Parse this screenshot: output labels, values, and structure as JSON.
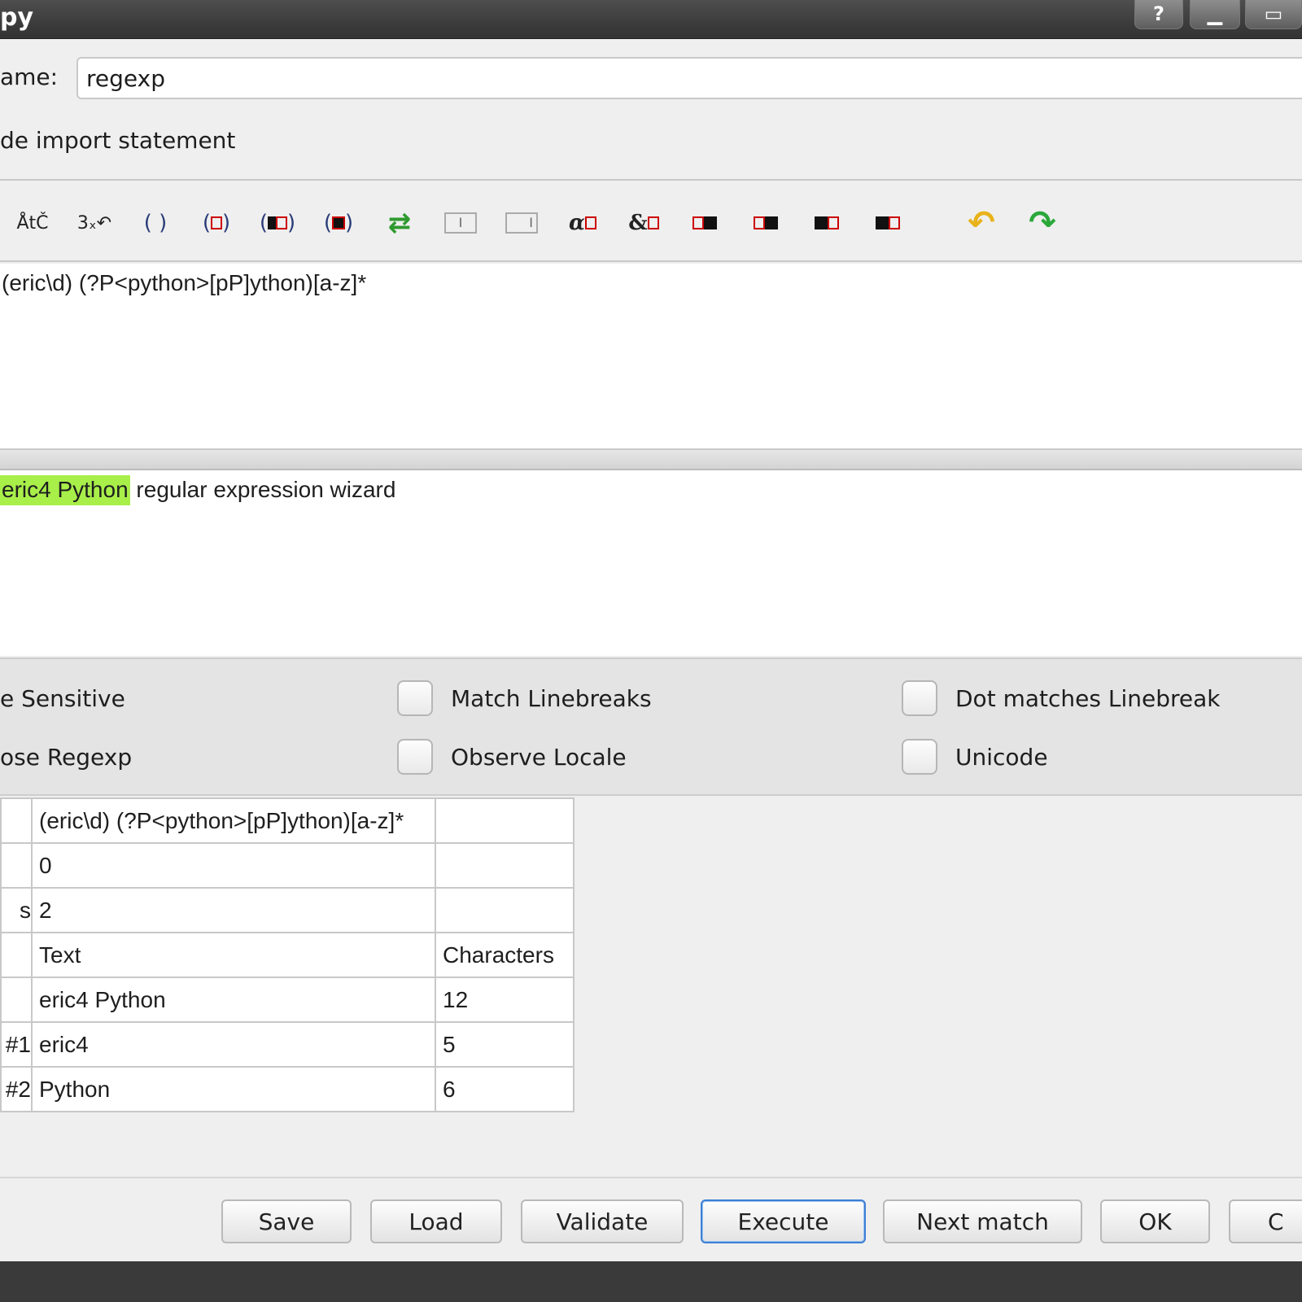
{
  "window": {
    "title": "py",
    "help_label": "?",
    "minimize_label": "▁",
    "maximize_label": "▭"
  },
  "form": {
    "name_label": "ame:",
    "name_value": "regexp",
    "import_label": "de import statement"
  },
  "toolbar": {
    "tools": [
      {
        "name": "character-tool-icon",
        "glyph": "ÅtČ"
      },
      {
        "name": "repeat-tool-icon",
        "glyph": "3ₓ↶"
      },
      {
        "name": "group-tool-icon",
        "glyph": "( )"
      },
      {
        "name": "named-group-tool-icon",
        "glyph": "(□)"
      },
      {
        "name": "named-reference-tool-icon",
        "glyph": "(▯□)"
      },
      {
        "name": "group-reference-tool-icon",
        "glyph": "(▮)"
      },
      {
        "name": "alternatives-tool-icon",
        "glyph": "⇄"
      },
      {
        "name": "begin-line-tool-icon",
        "glyph": "I"
      },
      {
        "name": "end-line-tool-icon",
        "glyph": "I"
      },
      {
        "name": "word-boundary-tool-icon",
        "glyph": "α"
      },
      {
        "name": "comment-tool-icon",
        "glyph": "&"
      },
      {
        "name": "positive-lookahead-tool-icon",
        "glyph": "+"
      },
      {
        "name": "negative-lookahead-tool-icon",
        "glyph": "−"
      },
      {
        "name": "positive-lookbehind-tool-icon",
        "glyph": "+"
      },
      {
        "name": "negative-lookbehind-tool-icon",
        "glyph": "−"
      },
      {
        "name": "undo-icon",
        "glyph": "↶"
      },
      {
        "name": "redo-icon",
        "glyph": "↷"
      }
    ]
  },
  "editor": {
    "regex": "(eric\\d) (?P<python>[pP]ython)[a-z]*"
  },
  "test": {
    "highlighted": "eric4 Python",
    "rest": " regular expression wizard"
  },
  "options": {
    "case_sensitive": "e Sensitive",
    "verbose_regexp": "ose Regexp",
    "match_linebreaks": "Match Linebreaks",
    "observe_locale": "Observe Locale",
    "dot_matches_linebreak": "Dot matches Linebreak",
    "unicode": "Unicode"
  },
  "results": {
    "rows": [
      {
        "label": "",
        "text": "(eric\\d) (?P<python>[pP]ython)[a-z]*",
        "chars": ""
      },
      {
        "label": "",
        "text": "0",
        "chars": ""
      },
      {
        "label": "s",
        "text": "2",
        "chars": ""
      },
      {
        "label": "",
        "text": "Text",
        "chars": "Characters"
      },
      {
        "label": "",
        "text": "eric4 Python",
        "chars": "12"
      },
      {
        "label": "#1",
        "text": "eric4",
        "chars": "5"
      },
      {
        "label": "#2",
        "text": "Python",
        "chars": "6"
      }
    ]
  },
  "buttons": {
    "save": "Save",
    "load": "Load",
    "validate": "Validate",
    "execute": "Execute",
    "next_match": "Next match",
    "ok": "OK",
    "cancel": "C"
  }
}
